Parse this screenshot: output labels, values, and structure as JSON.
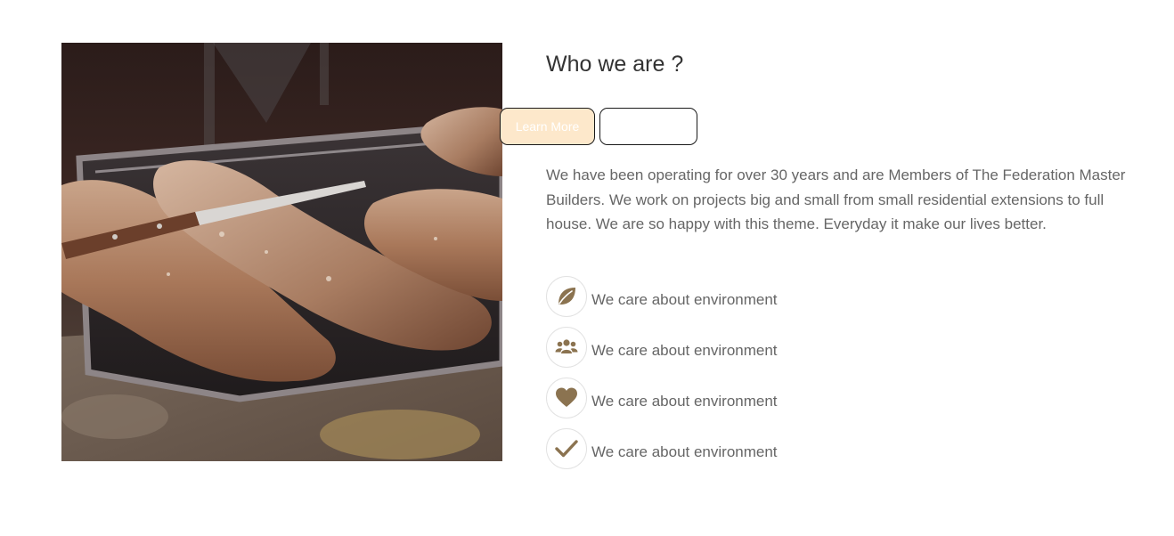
{
  "section": {
    "title": "Who we are ?",
    "description": "We have been operating for over 30 years and are Members of The Federation Master Builders. We work on projects big and small from small residential extensions to full house. We are so happy with this theme. Everyday it make our lives better.",
    "buttons": {
      "learn_more_label": "Learn More",
      "secondary_label": ""
    },
    "features": [
      {
        "icon": "leaf-icon",
        "label": "We care about environment"
      },
      {
        "icon": "users-icon",
        "label": "We care about environment"
      },
      {
        "icon": "heart-icon",
        "label": "We care about environment"
      },
      {
        "icon": "check-icon",
        "label": "We care about environment"
      }
    ]
  },
  "colors": {
    "accent": "#8b7350",
    "learn_more_bg": "#fde8cb",
    "text_muted": "#666666",
    "heading": "#333333"
  }
}
